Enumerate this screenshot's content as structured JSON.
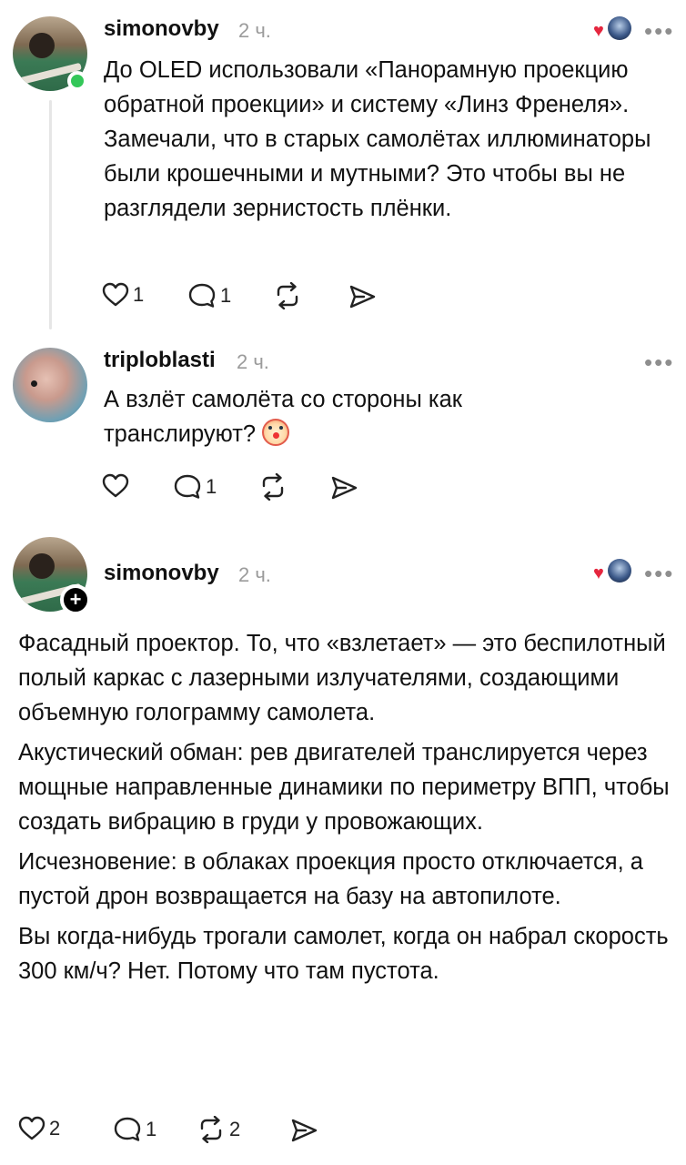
{
  "comments": [
    {
      "username": "simonovby",
      "time": "2 ч.",
      "text": [
        "До OLED использовали «Панорамную проекцию обратной проекции» и систему «Линз Френеля». Замечали, что в старых самолётах иллюминаторы были крошечными и мутными? Это чтобы вы не разглядели зернистость плёнки."
      ],
      "likes": "1",
      "replies": "1",
      "reposts": "",
      "avatar_icon": "avatar-billiards",
      "badge": "online"
    },
    {
      "username": "triploblasti",
      "time": "2 ч.",
      "text": [
        "А взлёт самолёта со стороны как транслируют?"
      ],
      "emoji": "clown-face-emoji",
      "likes": "",
      "replies": "1",
      "reposts": "",
      "avatar_icon": "avatar-fish"
    },
    {
      "username": "simonovby",
      "time": "2 ч.",
      "text": [
        "Фасадный проектор. То, что «взлетает» — это беспилотный полый каркас с лазерными излучателями, создающими объемную голограмму самолета.",
        "Акустический обман: рев двигателей транслируется через мощные направленные динамики по периметру ВПП, чтобы создать вибрацию в груди у провожающих.",
        "Исчезновение: в облаках проекция просто отключается, а пустой дрон возвращается на базу на автопилоте.",
        "Вы когда-нибудь трогали самолет, когда он набрал скорость 300 км/ч? Нет. Потому что там пустота."
      ],
      "likes": "2",
      "replies": "1",
      "reposts": "2",
      "avatar_icon": "avatar-billiards",
      "badge": "+"
    }
  ],
  "more_label": "•••",
  "colors": {
    "online": "#34c759",
    "heart": "#e5263e",
    "muted": "#9b9b9b"
  }
}
